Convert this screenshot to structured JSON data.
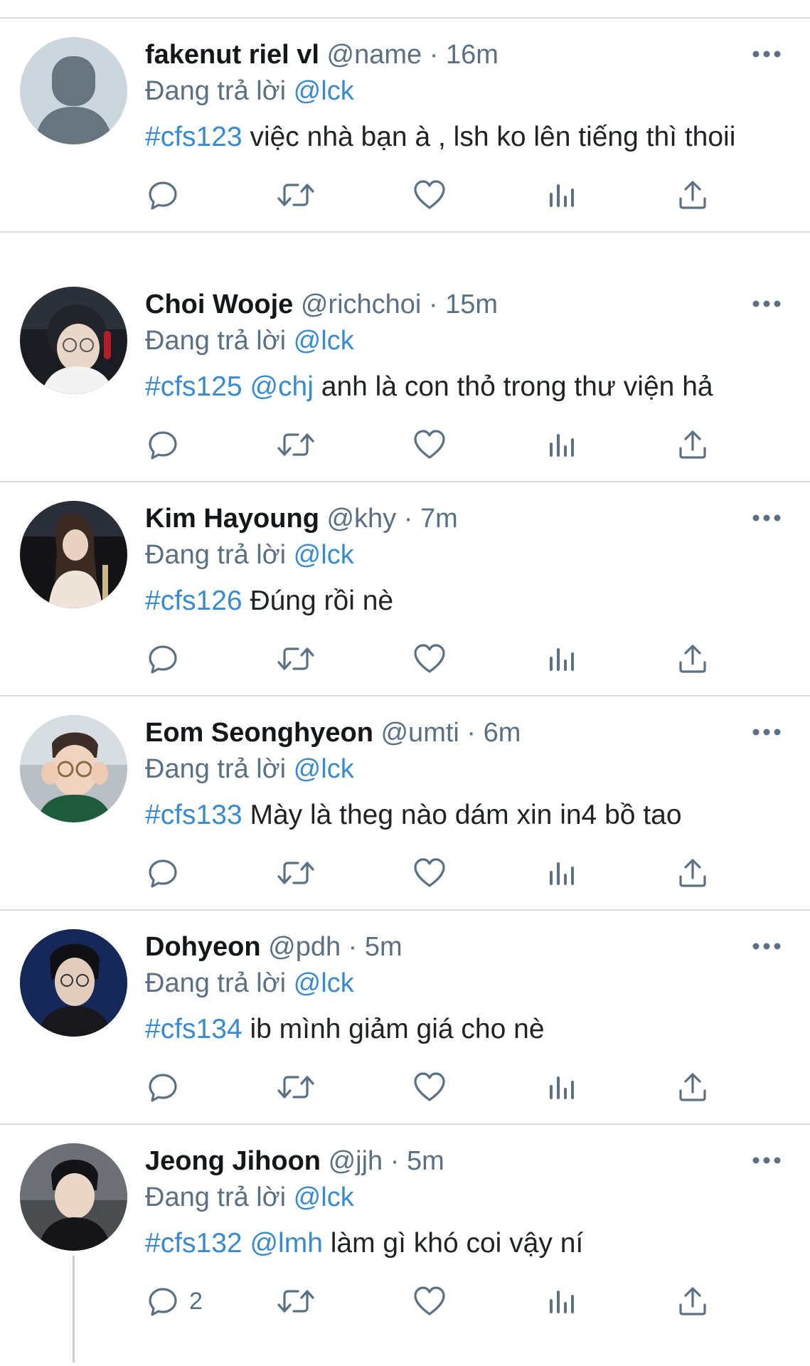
{
  "reply_prefix": "Đang trả lời",
  "reply_to": "@lck",
  "tweets": [
    {
      "name": "fakenut riel vl",
      "handle": "@name",
      "time": "16m",
      "tag": "#cfs123",
      "mention": "",
      "text": "việc nhà bạn à , lsh ko lên tiếng thì thoii",
      "reply_count": ""
    },
    {
      "name": "Choi Wooje",
      "handle": "@richchoi",
      "time": "15m",
      "tag": "#cfs125",
      "mention": "@chj",
      "text": "anh là con thỏ trong thư viện hả",
      "reply_count": ""
    },
    {
      "name": "Kim Hayoung",
      "handle": "@khy",
      "time": "7m",
      "tag": "#cfs126",
      "mention": "",
      "text": "Đúng rồi nè",
      "reply_count": ""
    },
    {
      "name": "Eom Seonghyeon",
      "handle": "@umti",
      "time": "6m",
      "tag": "#cfs133",
      "mention": "",
      "text": "Mày là theg nào dám xin in4 bồ tao",
      "reply_count": ""
    },
    {
      "name": "Dohyeon",
      "handle": "@pdh",
      "time": "5m",
      "tag": "#cfs134",
      "mention": "",
      "text": "ib mình giảm giá cho nè",
      "reply_count": ""
    },
    {
      "name": "Jeong Jihoon",
      "handle": "@jjh",
      "time": "5m",
      "tag": "#cfs132",
      "mention": "@lmh",
      "text": "làm gì khó coi vậy ní",
      "reply_count": "2"
    }
  ],
  "icons": {
    "reply": "reply-icon",
    "retweet": "retweet-icon",
    "like": "like-icon",
    "views": "views-icon",
    "share": "share-icon",
    "more": "more-icon"
  },
  "colors": {
    "link": "#3a8ad0",
    "muted": "#5b7083",
    "divider": "#dcdfe2"
  }
}
